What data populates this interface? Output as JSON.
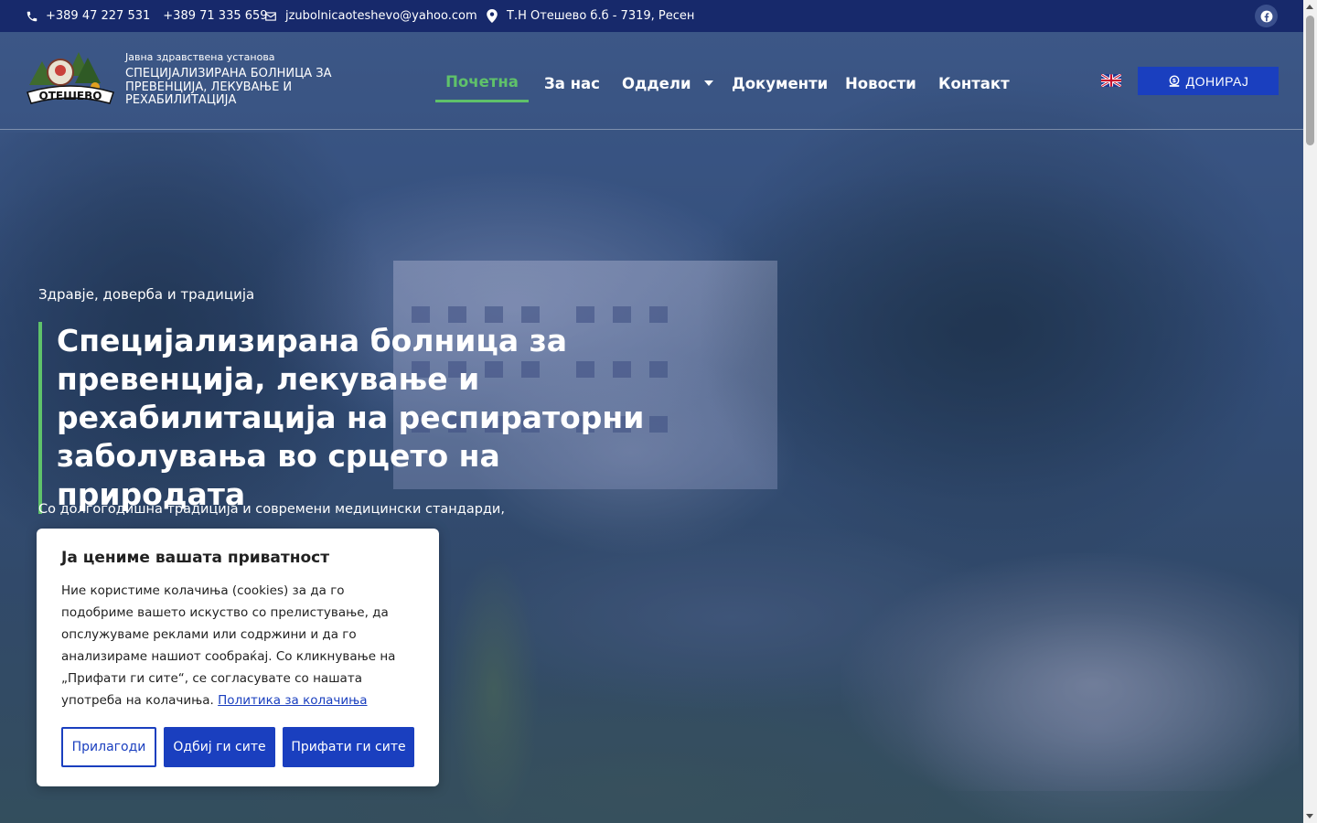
{
  "topbar": {
    "phone1": "+389 47 227 531",
    "phone2": "+389 71 335 659",
    "email": "jzubolnicaoteshevo@yahoo.com",
    "address": "Т.Н Отешево б.б - 7319, Ресен",
    "social_icon": "facebook-icon"
  },
  "header": {
    "logo_text": "ОТЕШЕВО",
    "institution_type": "Јавна здравствена установа",
    "institution_name": "Специјализирана болница за превенција, лекување и рехабилитација",
    "nav": [
      {
        "label": "Почетна",
        "active": true
      },
      {
        "label": "За нас"
      },
      {
        "label": "Оддели"
      },
      {
        "label": "Документи"
      },
      {
        "label": "Новости"
      },
      {
        "label": "Контакт"
      }
    ],
    "language_icon": "uk-flag-icon",
    "donate_label": "ДОНИРАЈ"
  },
  "hero": {
    "tagline": "Здравје, доверба и традиција",
    "headline": "Специјализирана болница за превенција, лекување и рехабилитација на респираторни заболувања во срцето на природата",
    "description": "Со долгогодишна традиција и современи медицински стандарди, нудиме"
  },
  "cookie": {
    "title": "Ја цениме вашата приватност",
    "body": "Ние користиме колачиња (cookies) за да го подобриме вашето искуство со прелистување, да опслужуваме реклами или содржини и да го анализираме нашиот сообраќај. Со кликнување на „Прифати ги сите“, се согласувате со нашата употреба на колачиња.",
    "policy_link": "Политика за колачиња",
    "customize_label": "Прилагоди",
    "reject_label": "Одбиј ги сите",
    "accept_label": "Прифати ги сите"
  },
  "colors": {
    "topbar_bg": "#17296b",
    "accent_green": "#5fc26a",
    "button_blue": "#1a3fbf"
  }
}
